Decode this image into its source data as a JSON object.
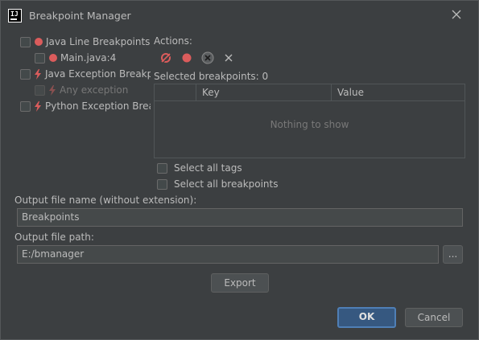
{
  "window": {
    "title": "Breakpoint Manager",
    "icon": "intellij-icon"
  },
  "tree": [
    {
      "label": "Java Line Breakpoints",
      "icon": "red-circle-icon",
      "level": 0,
      "disabled": false
    },
    {
      "label": "Main.java:4",
      "icon": "red-circle-icon",
      "level": 1,
      "disabled": false
    },
    {
      "label": "Java Exception Breakpoi",
      "icon": "lightning-icon",
      "level": 0,
      "disabled": false
    },
    {
      "label": "Any exception",
      "icon": "lightning-icon",
      "level": 1,
      "disabled": true
    },
    {
      "label": "Python Exception Breakp",
      "icon": "lightning-icon",
      "level": 0,
      "disabled": false
    }
  ],
  "actions": {
    "label": "Actions:",
    "icons": [
      "mute-breakpoints-icon",
      "breakpoint-icon",
      "remove-circle-icon",
      "close-icon"
    ]
  },
  "selected_label": "Selected breakpoints: 0",
  "table": {
    "columns": [
      "Key",
      "Value"
    ],
    "empty_text": "Nothing to show"
  },
  "options": {
    "select_all_tags": "Select all tags",
    "select_all_breakpoints": "Select all breakpoints"
  },
  "output": {
    "name_label": "Output file name (without extension):",
    "name_value": "Breakpoints",
    "path_label": "Output file path:",
    "path_value": "E:/bmanager",
    "browse_label": "..."
  },
  "buttons": {
    "export": "Export",
    "ok": "OK",
    "cancel": "Cancel"
  },
  "colors": {
    "background": "#3c3f41",
    "breakpoint_red": "#db5c5c",
    "primary_button": "#365880"
  }
}
